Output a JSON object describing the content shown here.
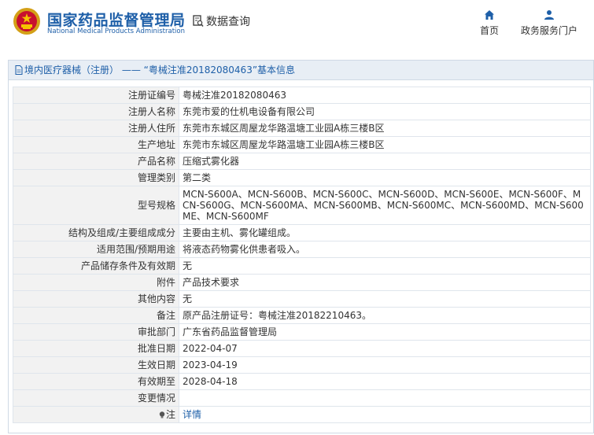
{
  "header": {
    "site_name_cn": "国家药品监督管理局",
    "site_name_en": "National Medical Products Administration",
    "query_label": "数据查询",
    "nav": [
      {
        "label": "首页",
        "icon": "home-icon"
      },
      {
        "label": "政务服务门户",
        "icon": "user-icon"
      }
    ],
    "brand_color": "#1e5fa8"
  },
  "panel": {
    "title": "境内医疗器械（注册） ——  “粤械注准20182080463”基本信息"
  },
  "rows": [
    {
      "key": "注册证编号",
      "value": "粤械注准20182080463"
    },
    {
      "key": "注册人名称",
      "value": "东莞市爱的仕机电设备有限公司"
    },
    {
      "key": "注册人住所",
      "value": "东莞市东城区周屋龙华路温塘工业园A栋三楼B区"
    },
    {
      "key": "生产地址",
      "value": "东莞市东城区周屋龙华路温塘工业园A栋三楼B区"
    },
    {
      "key": "产品名称",
      "value": "压缩式雾化器"
    },
    {
      "key": "管理类别",
      "value": "第二类"
    },
    {
      "key": "型号规格",
      "value": "MCN-S600A、MCN-S600B、MCN-S600C、MCN-S600D、MCN-S600E、MCN-S600F、MCN-S600G、MCN-S600MA、MCN-S600MB、MCN-S600MC、MCN-S600MD、MCN-S600ME、MCN-S600MF"
    },
    {
      "key": "结构及组成/主要组成成分",
      "value": "主要由主机、雾化罐组成。"
    },
    {
      "key": "适用范围/预期用途",
      "value": "将液态药物雾化供患者吸入。"
    },
    {
      "key": "产品储存条件及有效期",
      "value": "无"
    },
    {
      "key": "附件",
      "value": "产品技术要求"
    },
    {
      "key": "其他内容",
      "value": "无"
    },
    {
      "key": "备注",
      "value": "原产品注册证号：粤械注准20182210463。"
    },
    {
      "key": "审批部门",
      "value": "广东省药品监督管理局"
    },
    {
      "key": "批准日期",
      "value": "2022-04-07"
    },
    {
      "key": "生效日期",
      "value": "2023-04-19"
    },
    {
      "key": "有效期至",
      "value": "2028-04-18"
    },
    {
      "key": "变更情况",
      "value": ""
    }
  ],
  "note_row": {
    "key": "注",
    "link": "详情"
  }
}
